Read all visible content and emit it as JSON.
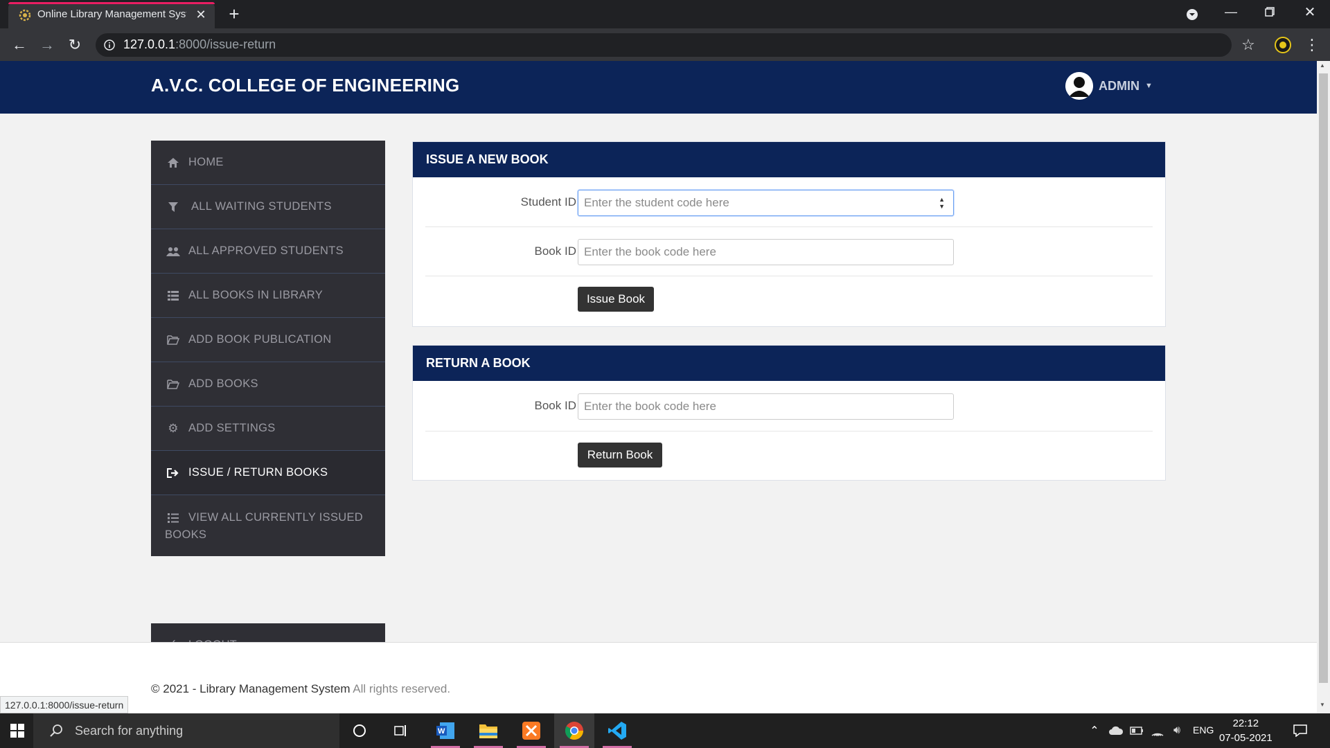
{
  "browser": {
    "tab_title": "Online Library Management Syst",
    "url_host": "127.0.0.1",
    "url_rest": ":8000/issue-return",
    "status_url": "127.0.0.1:8000/issue-return"
  },
  "header": {
    "brand": "A.V.C. COLLEGE OF ENGINEERING",
    "user": "ADMIN"
  },
  "sidebar": {
    "items": [
      {
        "label": "HOME",
        "icon": "home-icon"
      },
      {
        "label": "ALL WAITING STUDENTS",
        "icon": "filter-icon"
      },
      {
        "label": "ALL APPROVED STUDENTS",
        "icon": "users-icon"
      },
      {
        "label": "ALL BOOKS IN LIBRARY",
        "icon": "list-icon"
      },
      {
        "label": "ADD BOOK PUBLICATION",
        "icon": "folder-open-icon"
      },
      {
        "label": "ADD BOOKS",
        "icon": "folder-open-icon"
      },
      {
        "label": "ADD SETTINGS",
        "icon": "gear-icon"
      },
      {
        "label": "ISSUE / RETURN BOOKS",
        "icon": "sign-out-icon"
      },
      {
        "label_line1": "VIEW ALL CURRENTLY ISSUED",
        "label_line2": "BOOKS",
        "icon": "list-icon"
      }
    ],
    "logout": "LOGOUT"
  },
  "issue_panel": {
    "title": "ISSUE A NEW BOOK",
    "student_label": "Student ID",
    "student_placeholder": "Enter the student code here",
    "book_label": "Book ID",
    "book_placeholder": "Enter the book code here",
    "button": "Issue Book"
  },
  "return_panel": {
    "title": "RETURN A BOOK",
    "book_label": "Book ID",
    "book_placeholder": "Enter the book code here",
    "button": "Return Book"
  },
  "footer": {
    "copyright": "© 2021 - Library Management System",
    "rights": "All rights reserved."
  },
  "taskbar": {
    "search_placeholder": "Search for anything",
    "lang": "ENG",
    "time": "22:12",
    "date": "07-05-2021"
  },
  "colors": {
    "navbar": "#0c2458",
    "sidebar": "#2f2f35",
    "button": "#333333"
  }
}
